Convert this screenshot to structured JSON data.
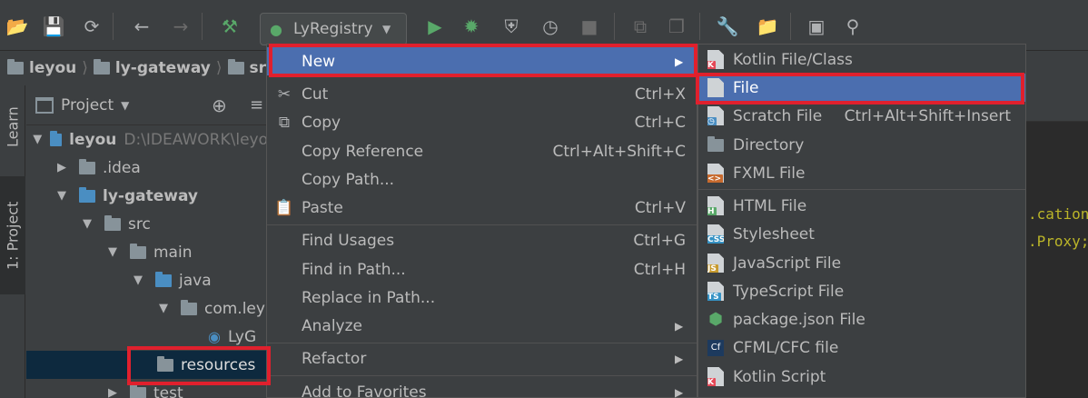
{
  "toolbar": {
    "run_config": "LyRegistry",
    "icons": [
      "open-folder-icon",
      "save-icon",
      "sync-icon",
      "back-icon",
      "forward-icon",
      "build-hammer-icon",
      "run-config-icon",
      "run-icon",
      "debug-icon",
      "coverage-icon",
      "profile-icon",
      "stop-icon",
      "attach-icon",
      "build-module-icon",
      "settings-wrench-icon",
      "project-structure-icon",
      "terminal-icon",
      "search-icon"
    ]
  },
  "breadcrumb": {
    "items": [
      "leyou",
      "ly-gateway",
      "sr"
    ]
  },
  "tool_strip": {
    "learn": "Learn",
    "project": "1: Project"
  },
  "project_panel": {
    "title": "Project",
    "tree": [
      {
        "label": "leyou",
        "extra": "D:\\IDEAWORK\\leyo",
        "bold": true
      },
      {
        "label": ".idea"
      },
      {
        "label": "ly-gateway",
        "bold": true
      },
      {
        "label": "src"
      },
      {
        "label": "main"
      },
      {
        "label": "java"
      },
      {
        "label": "com.ley"
      },
      {
        "label": "LyG"
      },
      {
        "label": "resources"
      },
      {
        "label": "test"
      }
    ]
  },
  "editor": {
    "lines": [
      ".cation",
      ".Proxy;"
    ]
  },
  "context_menu": {
    "items": [
      {
        "label": "New",
        "shortcut": "",
        "submenu": true
      },
      {
        "label": "Cut",
        "shortcut": "Ctrl+X"
      },
      {
        "label": "Copy",
        "shortcut": "Ctrl+C"
      },
      {
        "label": "Copy Reference",
        "shortcut": "Ctrl+Alt+Shift+C"
      },
      {
        "label": "Copy Path...",
        "shortcut": ""
      },
      {
        "label": "Paste",
        "shortcut": "Ctrl+V"
      },
      {
        "label": "Find Usages",
        "shortcut": "Ctrl+G"
      },
      {
        "label": "Find in Path...",
        "shortcut": "Ctrl+H"
      },
      {
        "label": "Replace in Path...",
        "shortcut": ""
      },
      {
        "label": "Analyze",
        "shortcut": "",
        "submenu": true
      },
      {
        "label": "Refactor",
        "shortcut": "",
        "submenu": true
      },
      {
        "label": "Add to Favorites",
        "shortcut": "",
        "submenu": true
      }
    ]
  },
  "new_submenu": {
    "items": [
      {
        "label": "Kotlin File/Class",
        "shortcut": ""
      },
      {
        "label": "File",
        "shortcut": ""
      },
      {
        "label": "Scratch File",
        "shortcut": "Ctrl+Alt+Shift+Insert"
      },
      {
        "label": "Directory",
        "shortcut": ""
      },
      {
        "label": "FXML File",
        "shortcut": ""
      },
      {
        "label": "HTML File",
        "shortcut": ""
      },
      {
        "label": "Stylesheet",
        "shortcut": ""
      },
      {
        "label": "JavaScript File",
        "shortcut": ""
      },
      {
        "label": "TypeScript File",
        "shortcut": ""
      },
      {
        "label": "package.json File",
        "shortcut": ""
      },
      {
        "label": "CFML/CFC file",
        "shortcut": ""
      },
      {
        "label": "Kotlin Script",
        "shortcut": ""
      }
    ]
  },
  "colors": {
    "selection": "#4b6eaf",
    "highlight": "#e0202d",
    "background": "#3c3f41"
  }
}
